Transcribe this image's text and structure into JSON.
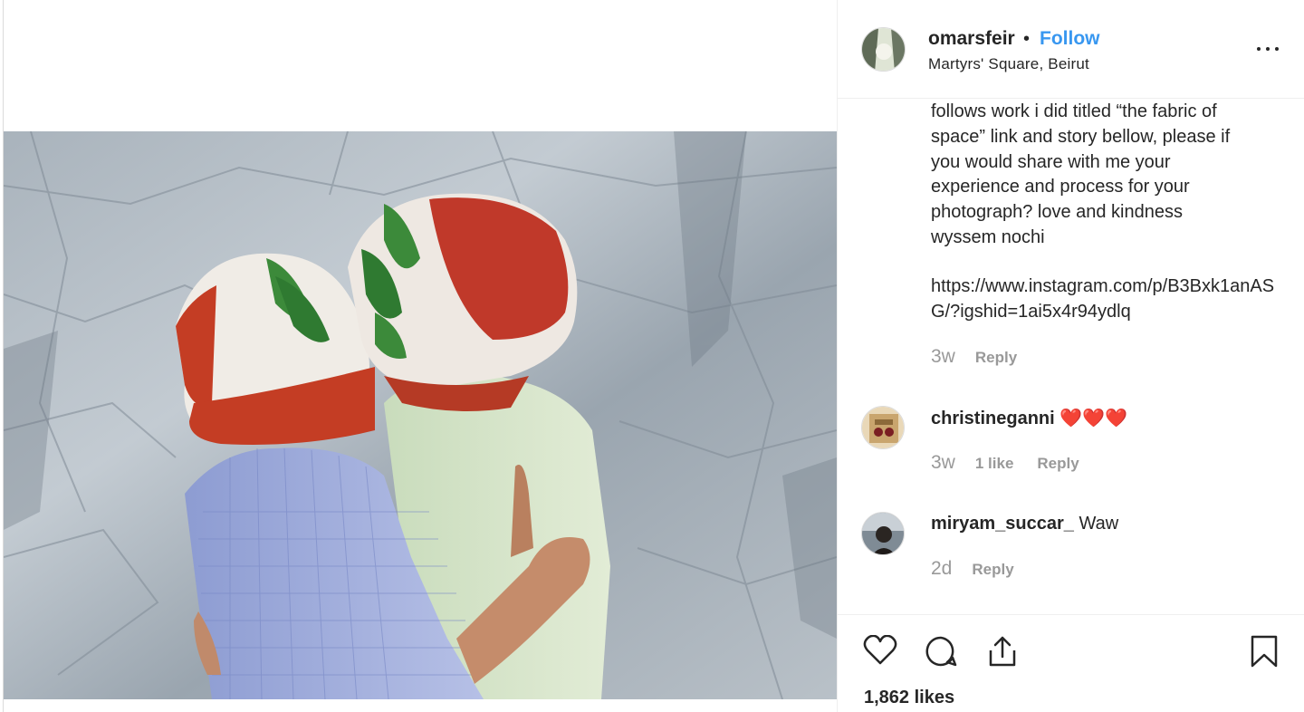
{
  "post": {
    "username": "omarsfeir",
    "separator": "•",
    "follow_label": "Follow",
    "location": "Martyrs' Square, Beirut",
    "more_icon": "more-options-icon"
  },
  "caption": {
    "text": "follows work i did titled “the fabric of\nspace” link and story bellow, please if\nyou would share with me your\nexperience and process for your\nphotograph? love and kindness\nwyssem nochi",
    "link": "https://www.instagram.com/p/B3Bxk1anASG/?igshid=1ai5x4r94ydlq",
    "time": "3w",
    "reply_label": "Reply"
  },
  "comments": [
    {
      "username": "christineganni",
      "text": "❤️❤️❤️",
      "time": "3w",
      "likes": "1 like",
      "reply_label": "Reply"
    },
    {
      "username": "miryam_succar_",
      "text": "Waw",
      "time": "2d",
      "reply_label": "Reply"
    }
  ],
  "actions": {
    "like_icon": "heart-icon",
    "comment_icon": "comment-icon",
    "share_icon": "share-icon",
    "save_icon": "bookmark-icon",
    "likes_count": "1,862 likes"
  },
  "colors": {
    "link_blue": "#3897f0",
    "text": "#262626",
    "muted": "#999999",
    "divider": "#efefef",
    "heart_red": "#e0242b"
  }
}
